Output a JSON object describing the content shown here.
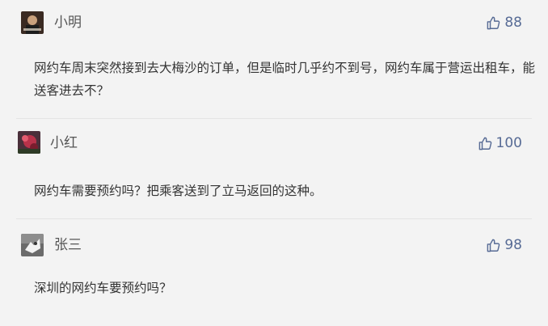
{
  "comments": [
    {
      "username": "小明",
      "likes": "88",
      "content": "网约车周末突然接到去大梅沙的订单，但是临时几乎约不到号，网约车属于营运出租车，能送客进去不？"
    },
    {
      "username": "小红",
      "likes": "100",
      "content": "网约车需要预约吗？把乘客送到了立马返回的这种。"
    },
    {
      "username": "张三",
      "likes": "98",
      "content": "深圳的网约车要预约吗？"
    }
  ],
  "colors": {
    "background": "#f3f3f3",
    "accent": "#576b95",
    "text": "#333333"
  },
  "icons": {
    "like": "thumbs-up-icon"
  }
}
